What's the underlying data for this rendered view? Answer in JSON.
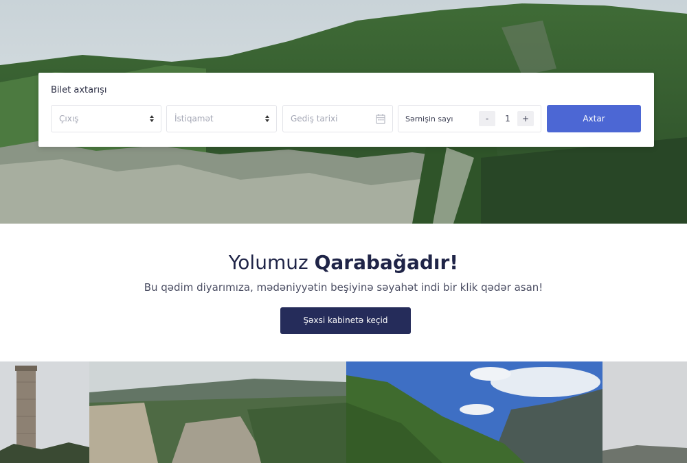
{
  "search": {
    "title": "Bilet axtarışı",
    "departure_placeholder": "Çıxış",
    "destination_placeholder": "İstiqamət",
    "date_placeholder": "Gediş tarixi",
    "passenger_label": "Sərnişin sayı",
    "passenger_count": "1",
    "minus_label": "-",
    "plus_label": "+",
    "submit_label": "Axtar"
  },
  "promo": {
    "headline_regular": "Yolumuz ",
    "headline_bold": "Qarabağadır!",
    "subtitle": "Bu qədim diyarımıza, mədəniyyətin beşiyinə səyahət indi bir klik qədər asan!",
    "cta_label": "Şəxsi kabinetə keçid"
  },
  "colors": {
    "primary": "#4c67d4",
    "dark_navy": "#252c5a",
    "heading": "#1f2447"
  },
  "icons": {
    "select_arrow": "sort-arrows-icon",
    "calendar": "calendar-icon"
  }
}
